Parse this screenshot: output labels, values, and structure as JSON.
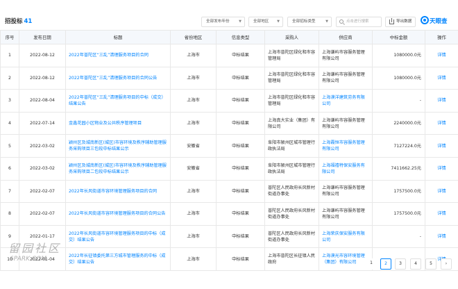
{
  "header": {
    "title": "招投标",
    "count": "41",
    "filters": {
      "year": "全部发布年份",
      "region": "全部地区",
      "type": "全部招标类型"
    },
    "search_placeholder": "点击进行搜索",
    "export_label": "导出数据",
    "logo_text": "天眼查"
  },
  "table": {
    "columns": [
      "序号",
      "发布日期",
      "标题",
      "省份地区",
      "信息类型",
      "采购人",
      "供应商",
      "中标金额",
      "操作"
    ],
    "rows": [
      {
        "no": "1",
        "date": "2022-08-12",
        "title": "2022年普陀区“三乱”清理服务项目的合同",
        "region": "上海市",
        "type": "中标结果",
        "buyer": "上海市普陀区绿化和市容管理局",
        "supplier": "上海谦屿市容服务管理有限公司",
        "supplier_link": false,
        "amount": "1080000.0元",
        "action": "详情"
      },
      {
        "no": "2",
        "date": "2022-08-12",
        "title": "2022年普陀区“三乱”清理服务项目的合同公告",
        "region": "上海市",
        "type": "中标结果",
        "buyer": "上海市普陀区绿化和市容管理局",
        "supplier": "上海谦屿市容服务管理有限公司",
        "supplier_link": false,
        "amount": "1080000.0元",
        "action": "详情"
      },
      {
        "no": "3",
        "date": "2022-08-04",
        "title": "2022年普陀区“三乱”清理服务项目的中标（成交）结果公告",
        "region": "上海市",
        "type": "中标结果",
        "buyer": "上海市普陀区绿化和市容管理局",
        "supplier": "上海漠洋建筑劳务有限公司",
        "supplier_link": true,
        "amount": "-",
        "action": "详情"
      },
      {
        "no": "4",
        "date": "2022-07-14",
        "title": "金鑫花园小区物业及公共秩序管理项目",
        "region": "上海市",
        "type": "中标结果",
        "buyer": "上海真大实业（集团）有限公司",
        "supplier": "上海谦屿市容服务管理有限公司",
        "supplier_link": false,
        "amount": "2240000.0元",
        "action": "详情"
      },
      {
        "no": "5",
        "date": "2022-03-02",
        "title": "颖州区及城南新区(城区)市容环境及秩序辅助管理服务采购项目三包段中标结果公示",
        "region": "安徽省",
        "type": "中标结果",
        "buyer": "阜阳市颍州区城市管理行政执法局",
        "supplier": "上海霞恒市容服务管理有限公司",
        "supplier_link": true,
        "amount": "7127224.0元",
        "action": "详情"
      },
      {
        "no": "6",
        "date": "2022-03-02",
        "title": "颖州区及城南新区(城区)市容环境及秩序辅助管理服务采购项目二包段中标结果公示",
        "region": "安徽省",
        "type": "中标结果",
        "buyer": "阜阳市颍州区城市管理行政执法局",
        "supplier": "上海福禧特保安服务有限公司",
        "supplier_link": true,
        "amount": "7411662.25元",
        "action": "详情"
      },
      {
        "no": "7",
        "date": "2022-02-07",
        "title": "2022年长风街道市容环境管理服务项目的合同",
        "region": "上海市",
        "type": "中标结果",
        "buyer": "普陀区人民政府长风新村街道办事处",
        "supplier": "上海谦屿市容服务管理有限公司",
        "supplier_link": false,
        "amount": "1757500.0元",
        "action": "详情"
      },
      {
        "no": "8",
        "date": "2022-02-07",
        "title": "2022年长风街道市容环境管理服务项目的合同公告",
        "region": "上海市",
        "type": "中标结果",
        "buyer": "普陀区人民政府长风新村街道办事处",
        "supplier": "上海谦屿市容服务管理有限公司",
        "supplier_link": false,
        "amount": "1757500.0元",
        "action": "详情"
      },
      {
        "no": "9",
        "date": "2022-01-17",
        "title": "2022年长风街道市容环境管理服务项目的中标（成交）结果公告",
        "region": "上海市",
        "type": "中标结果",
        "buyer": "普陀区人民政府长风新村街道办事处",
        "supplier": "上海荣庆保安服务有限公司",
        "supplier_link": true,
        "amount": "-",
        "action": "详情"
      },
      {
        "no": "10",
        "date": "2022-01-04",
        "title": "2022年长征镇委托第三方城市管理服务的中标（成交）结果公告",
        "region": "上海市",
        "type": "中标结果",
        "buyer": "上海市普陀区长征镇人民政府",
        "supplier": "上海漠光市容环境管理（集团）有限公司",
        "supplier_link": true,
        "amount": "-",
        "action": "详情"
      }
    ]
  },
  "pagination": {
    "pages": [
      "1",
      "2",
      "3",
      "4",
      "5"
    ],
    "active": "1",
    "next": "›"
  },
  "watermark": {
    "line1": "留园社区",
    "line2": "6PARK.COM"
  },
  "colors": {
    "accent": "#0084ff",
    "header_bg": "#f5f8fc",
    "border": "#e8e8e8"
  }
}
